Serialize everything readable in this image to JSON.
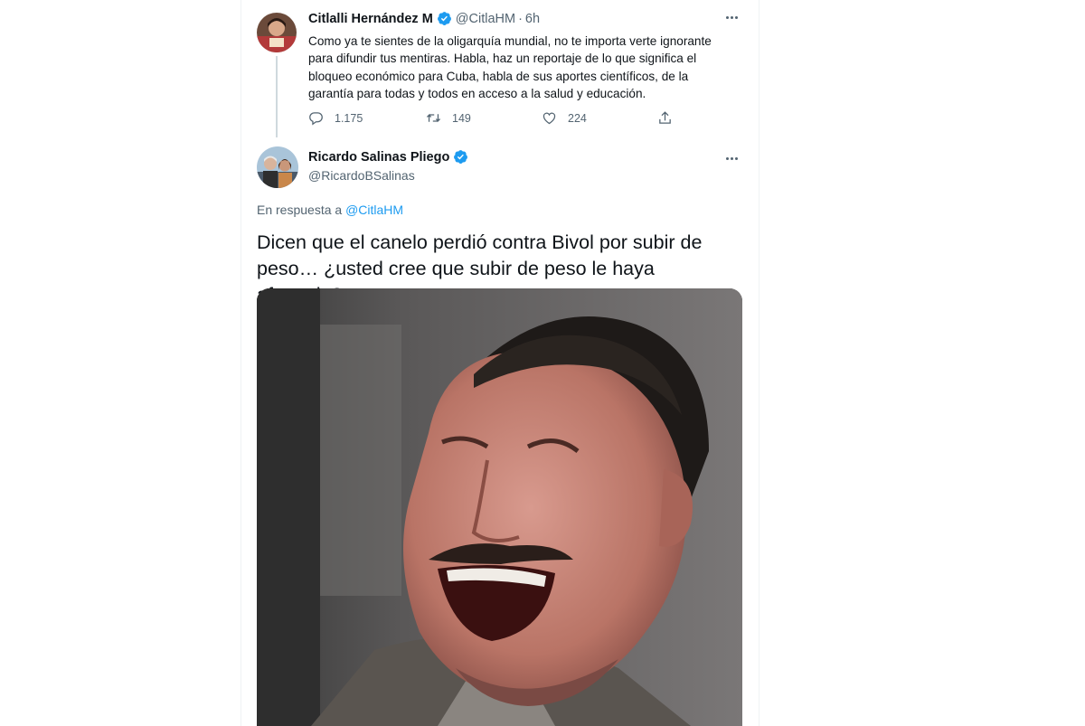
{
  "tweet1": {
    "author_name": "Citlalli Hernández M",
    "handle": "@CitlaHM",
    "time": "6h",
    "text": "Como ya te sientes de la oligarquía mundial, no te importa verte ignorante para difundir tus mentiras. Habla, haz un reportaje de lo que significa el bloqueo económico para Cuba, habla de sus aportes científicos, de la garantía para todas y todos en acceso a la salud y educación.",
    "replies": "1.175",
    "retweets": "149",
    "likes": "224"
  },
  "tweet2": {
    "author_name": "Ricardo Salinas Pliego",
    "handle": "@RicardoBSalinas",
    "reply_prefix": "En respuesta a",
    "reply_mention": "@CitlaHM",
    "text": "Dicen que el canelo perdió contra Bivol por subir de peso… ¿usted cree que subir de peso le haya afectado?"
  },
  "icons": {
    "verified": "verified-badge-icon",
    "more": "more-options-icon",
    "reply": "reply-icon",
    "retweet": "retweet-icon",
    "like": "heart-icon",
    "share": "share-icon"
  },
  "colors": {
    "accent": "#1d9bf0",
    "secondary_text": "#536471",
    "primary_text": "#0f1419"
  }
}
